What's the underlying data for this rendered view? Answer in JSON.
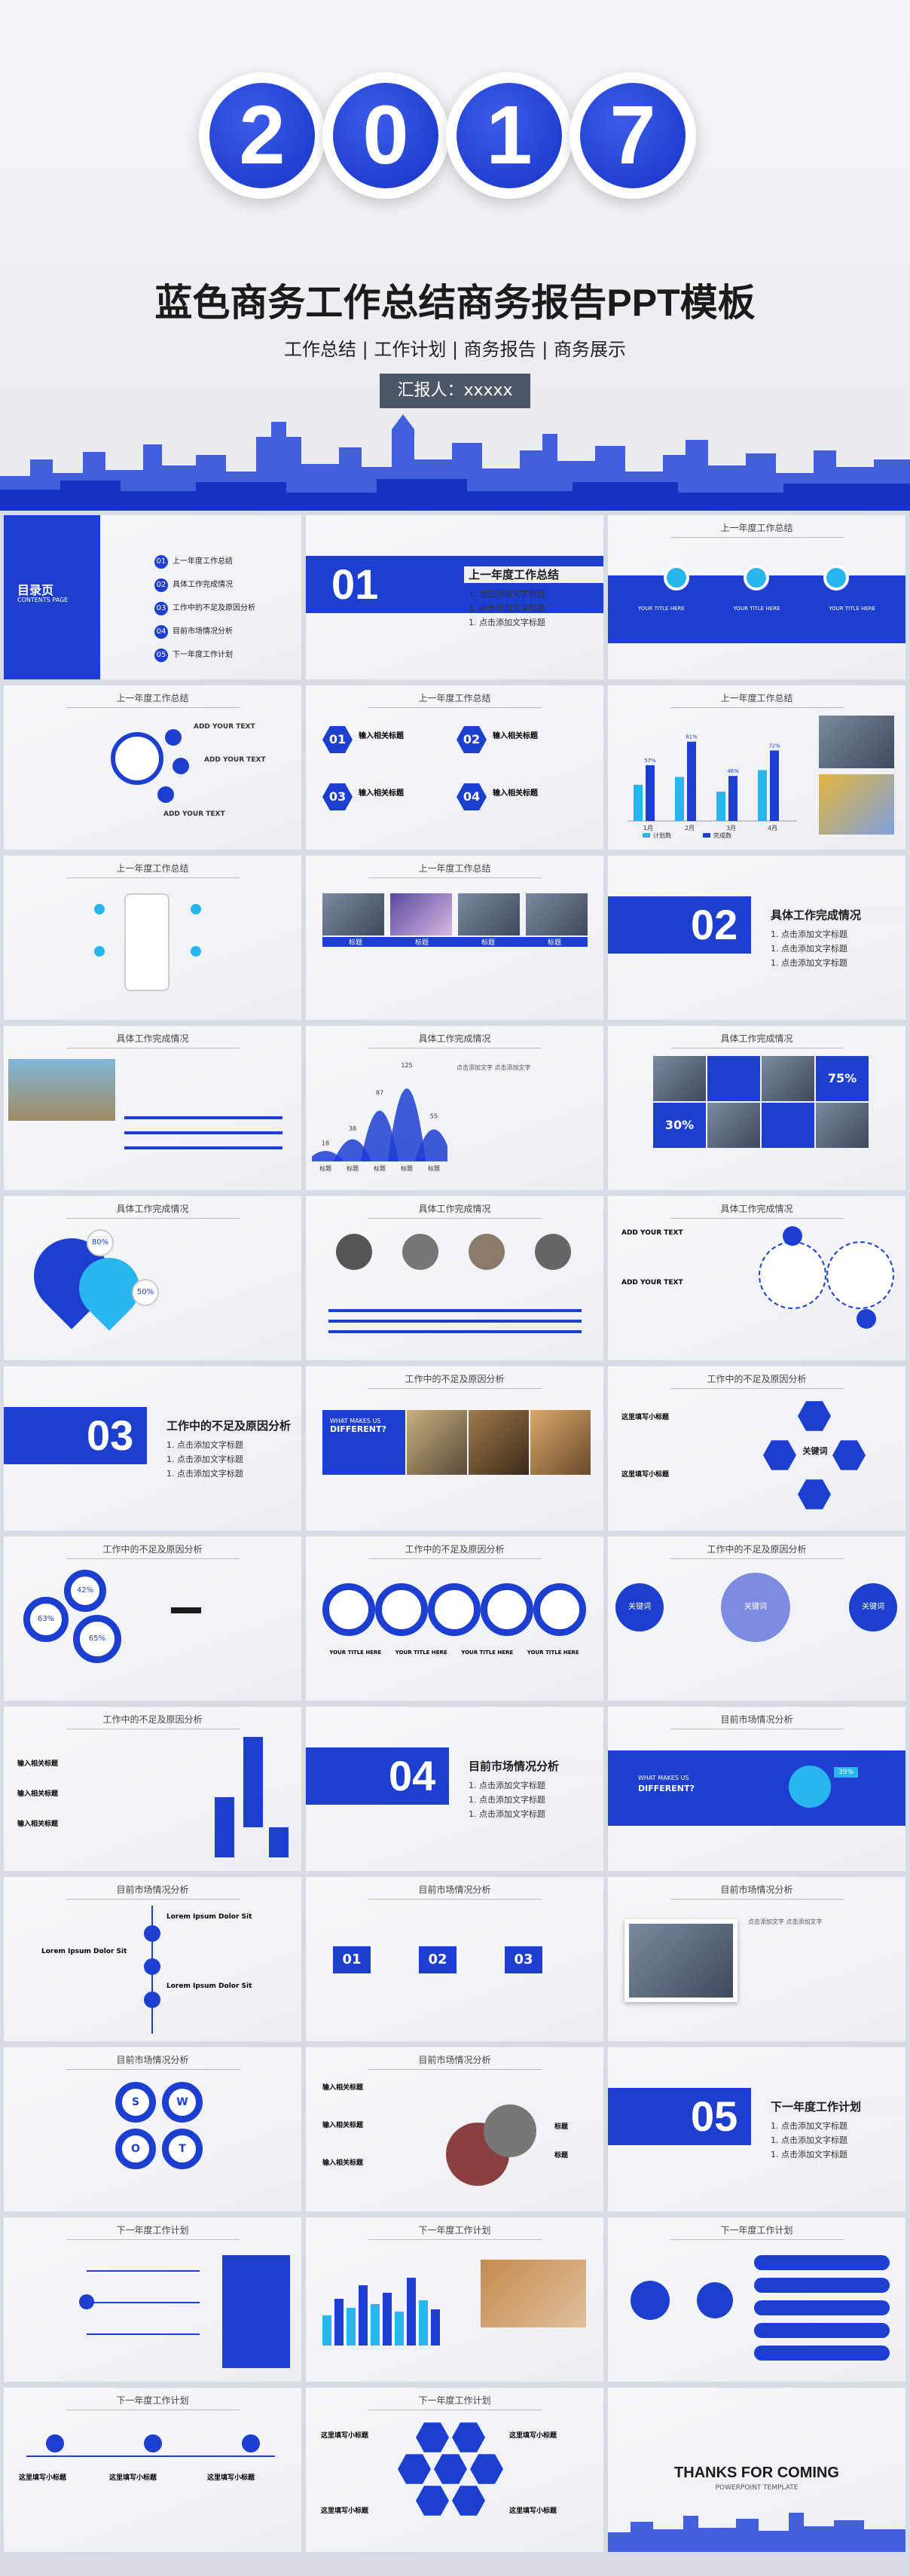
{
  "hero": {
    "year_digits": [
      "2",
      "0",
      "1",
      "7"
    ],
    "title": "蓝色商务工作总结商务报告PPT模板",
    "subtitle": "工作总结 | 工作计划 | 商务报告 | 商务展示",
    "reporter": "汇报人：xxxxx"
  },
  "colors": {
    "accent": "#1d3fd0",
    "dark_badge": "#4d5666",
    "background": "#eceef2"
  },
  "toc": {
    "title": "目录页",
    "subtitle": "CONTENTS PAGE",
    "items": [
      "上一年度工作总结",
      "具体工作完成情况",
      "工作中的不足及原因分析",
      "目前市场情况分析",
      "下一年度工作计划"
    ],
    "numbers": [
      "01",
      "02",
      "03",
      "04",
      "05"
    ]
  },
  "sections": [
    {
      "num": "01",
      "label": "上一年度工作总结",
      "items": [
        "点击添加文字标题",
        "点击添加文字标题",
        "点击添加文字标题"
      ]
    },
    {
      "num": "02",
      "label": "具体工作完成情况",
      "items": [
        "点击添加文字标题",
        "点击添加文字标题",
        "点击添加文字标题"
      ]
    },
    {
      "num": "03",
      "label": "工作中的不足及原因分析",
      "items": [
        "点击添加文字标题",
        "点击添加文字标题",
        "点击添加文字标题"
      ]
    },
    {
      "num": "04",
      "label": "目前市场情况分析",
      "items": [
        "点击添加文字标题",
        "点击添加文字标题",
        "点击添加文字标题"
      ]
    },
    {
      "num": "05",
      "label": "下一年度工作计划",
      "items": [
        "点击添加文字标题",
        "点击添加文字标题",
        "点击添加文字标题"
      ]
    }
  ],
  "headers": {
    "s1": "上一年度工作总结",
    "s2": "具体工作完成情况",
    "s3": "工作中的不足及原因分析",
    "s4": "目前市场情况分析",
    "s5": "下一年度工作计划"
  },
  "labels": {
    "your_title": "YOUR TITLE HERE",
    "add_your_text": "ADD YOUR TEXT",
    "input_title": "输入相关标题",
    "tag": "标题",
    "keyword": "关键词",
    "what_makes": "WHAT MAKES US",
    "different": "DIFFERENT?",
    "lorem_title": "Lorem Ipsum Dolor Sit",
    "fill_title": "这里填写小标题",
    "click_add": "点击添加文字 点击添加文字",
    "percent_75": "75%",
    "percent_30": "30%",
    "percent_80": "80%",
    "percent_50": "50%",
    "percent_42": "42%",
    "percent_63": "63%",
    "percent_65": "65%",
    "percent_39": "39%",
    "thanks": "THANKS FOR COMING",
    "template": "POWERPOINT TEMPLATE",
    "swot": [
      "S",
      "W",
      "O",
      "T"
    ],
    "hex_nums": [
      "01",
      "02",
      "03",
      "04"
    ]
  },
  "chart_data": [
    {
      "type": "bar",
      "categories": [
        "1月",
        "2月",
        "3月",
        "4月"
      ],
      "series": [
        {
          "name": "计划数",
          "values": [
            37,
            45,
            30,
            52
          ]
        },
        {
          "name": "完成数",
          "values": [
            57,
            81,
            46,
            72
          ]
        }
      ],
      "data_labels": [
        "57%",
        "81%",
        "46%",
        "72%"
      ],
      "ylim": [
        0,
        100
      ]
    },
    {
      "type": "area",
      "categories": [
        "标题",
        "标题",
        "标题",
        "标题",
        "标题"
      ],
      "values": [
        18,
        38,
        87,
        125,
        55
      ],
      "ylim": [
        0,
        130
      ]
    }
  ]
}
